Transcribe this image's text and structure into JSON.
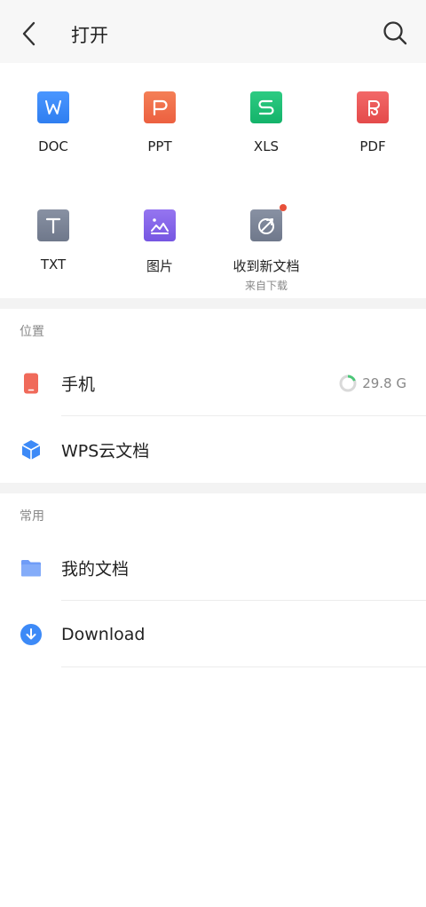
{
  "header": {
    "title": "打开"
  },
  "file_types": [
    {
      "label": "DOC",
      "glyph": "W",
      "color": "#3d8af7"
    },
    {
      "label": "PPT",
      "glyph": "P",
      "color": "#f0704a"
    },
    {
      "label": "XLS",
      "glyph": "S",
      "color": "#1fbf75"
    },
    {
      "label": "PDF",
      "glyph": "P",
      "color": "#ee5a5a"
    },
    {
      "label": "TXT",
      "glyph": "T",
      "color": "#7c8597"
    },
    {
      "label": "图片",
      "glyph": "",
      "color": "#8466e9"
    },
    {
      "label": "收到新文档",
      "sublabel": "来自下载",
      "glyph": "",
      "color": "#7c8597"
    }
  ],
  "location": {
    "header": "位置",
    "items": [
      {
        "label": "手机",
        "storage": "29.8 G",
        "storage_used_fraction": 0.18
      },
      {
        "label": "WPS云文档"
      }
    ]
  },
  "common": {
    "header": "常用",
    "items": [
      {
        "label": "我的文档"
      },
      {
        "label": "Download"
      }
    ]
  },
  "colors": {
    "accent": "#3d8af7",
    "phone": "#f06a5a",
    "folder": "#6f9cf7",
    "storage_ring": "#4cc778"
  }
}
